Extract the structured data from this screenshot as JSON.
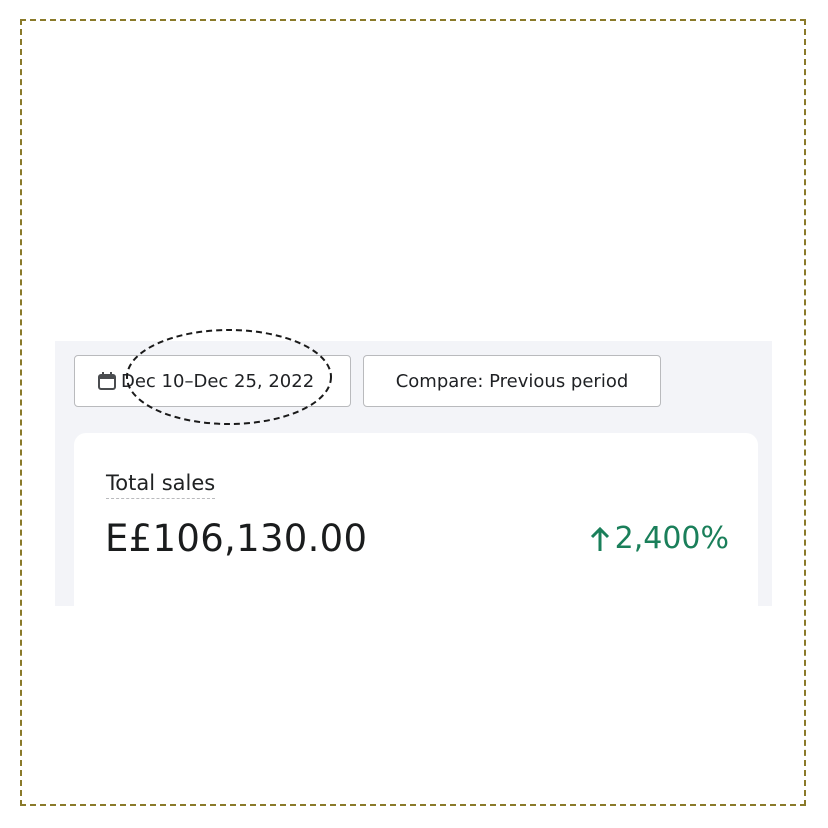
{
  "toolbar": {
    "date_range_label": "Dec 10–Dec 25, 2022",
    "date_icon": "calendar-icon",
    "compare_label": "Compare: Previous period"
  },
  "metric_card": {
    "label": "Total sales",
    "value": "E£106,130.00",
    "change": "2,400%",
    "change_direction": "up",
    "change_icon": "arrow-up-icon",
    "change_color": "#1a7f5a"
  },
  "colors": {
    "panel_background": "#f3f4f8",
    "card_background": "#ffffff",
    "frame_border": "#8a7a2a"
  }
}
